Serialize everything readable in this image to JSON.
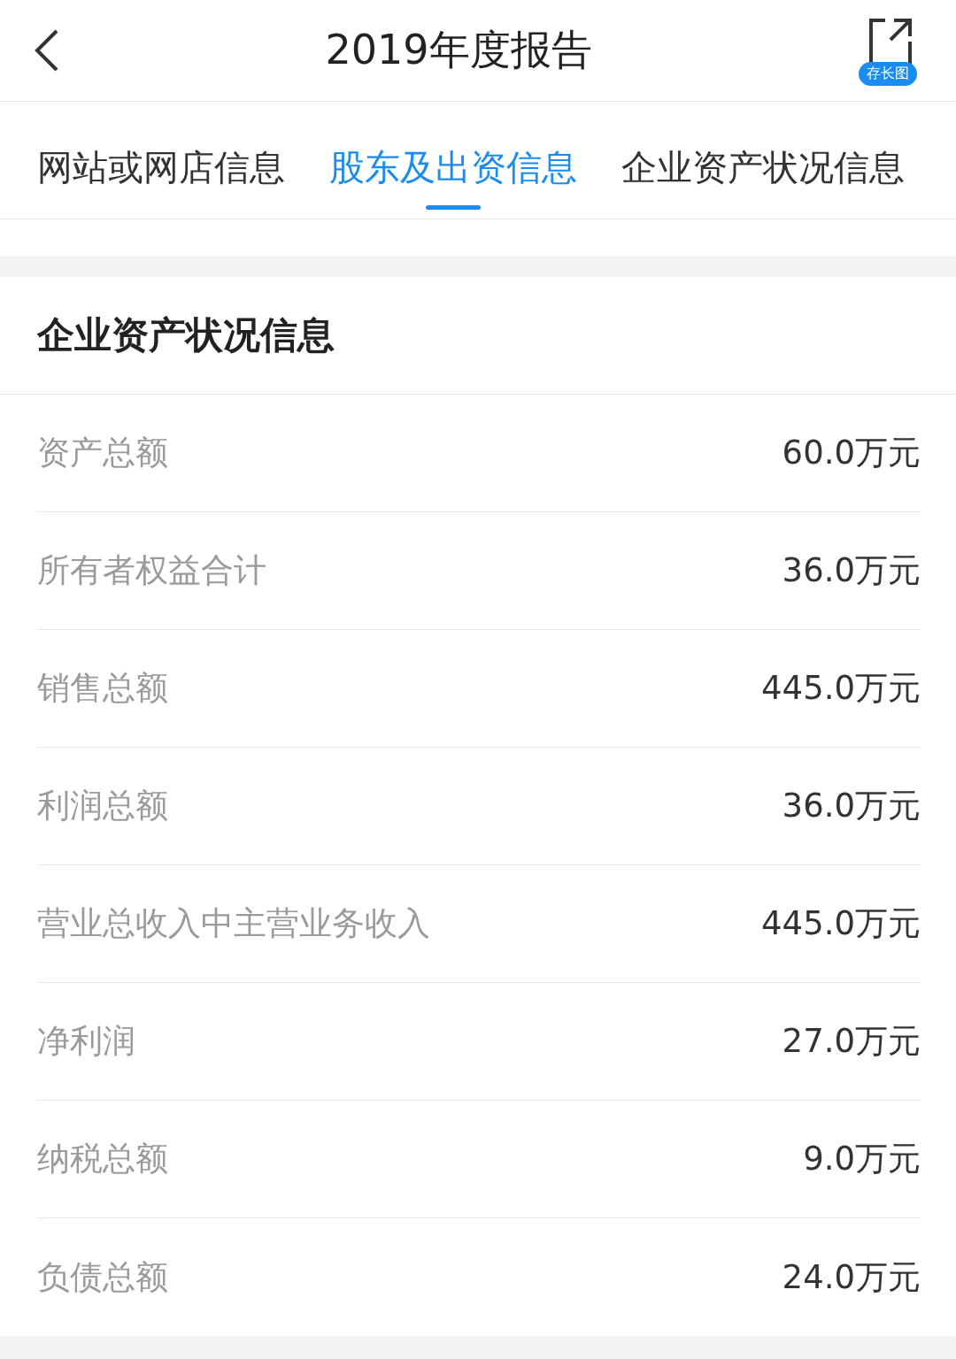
{
  "header": {
    "title": "2019年度报告",
    "share_badge": "存长图"
  },
  "tabs": [
    {
      "label": "网站或网店信息",
      "selected": false
    },
    {
      "label": "股东及出资信息",
      "selected": true
    },
    {
      "label": "企业资产状况信息",
      "selected": false
    }
  ],
  "section": {
    "title": "企业资产状况信息",
    "rows": [
      {
        "label": "资产总额",
        "value": "60.0万元"
      },
      {
        "label": "所有者权益合计",
        "value": "36.0万元"
      },
      {
        "label": "销售总额",
        "value": "445.0万元"
      },
      {
        "label": "利润总额",
        "value": "36.0万元"
      },
      {
        "label": "营业总收入中主营业务收入",
        "value": "445.0万元"
      },
      {
        "label": "净利润",
        "value": "27.0万元"
      },
      {
        "label": "纳税总额",
        "value": "9.0万元"
      },
      {
        "label": "负债总额",
        "value": "24.0万元"
      }
    ]
  }
}
